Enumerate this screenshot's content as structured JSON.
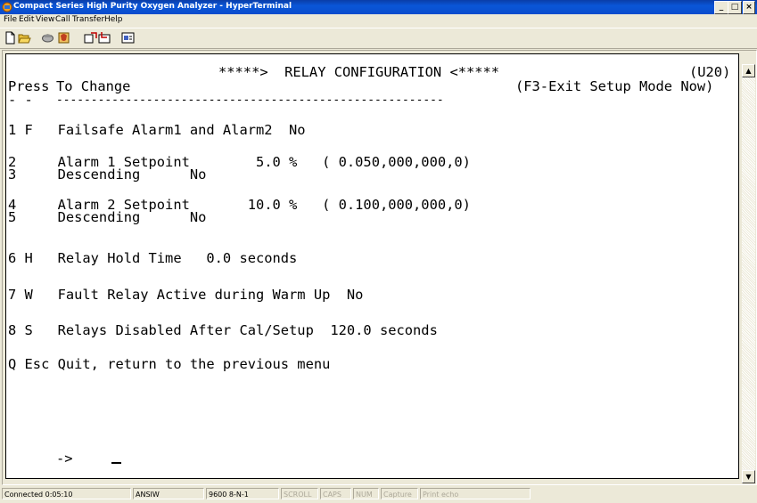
{
  "window": {
    "title": "Compact Series High Purity Oxygen Analyzer - HyperTerminal",
    "minimize": "_",
    "maximize": "□",
    "close": "×"
  },
  "menu": [
    "File",
    "Edit",
    "View",
    "Call",
    "Transfer",
    "Help"
  ],
  "toolbar_icons": [
    "new-icon",
    "open-icon",
    "disconnect-icon",
    "dial-icon",
    "send-icon",
    "receive-icon",
    "properties-icon"
  ],
  "terminal": {
    "header_title": "*****>  RELAY CONFIGURATION <*****",
    "screen_id": "(U20)",
    "press_label": "Press",
    "to_change": "To Change",
    "exit_hint": "(F3-Exit Setup Mode Now)",
    "separator_left": "- -",
    "separator": "--------------------------------------------------------",
    "lines": [
      "1 F   Failsafe Alarm1 and Alarm2  No",
      "2     Alarm 1 Setpoint        5.0 %   ( 0.050,000,000,0)",
      "3     Descending      No",
      "4     Alarm 2 Setpoint       10.0 %   ( 0.100,000,000,0)",
      "5     Descending      No",
      "6 H   Relay Hold Time   0.0 seconds",
      "7 W   Fault Relay Active during Warm Up  No",
      "8 S   Relays Disabled After Cal/Setup  120.0 seconds",
      "Q Esc Quit, return to the previous menu"
    ],
    "prompt": "->"
  },
  "status": {
    "connected": "Connected 0:05:10",
    "emulation": "ANSIW",
    "port": "9600 8-N-1",
    "scroll": "SCROLL",
    "caps": "CAPS",
    "num": "NUM",
    "capture": "Capture",
    "print_echo": "Print echo"
  },
  "colors": {
    "title_bar": "#0a4ccc",
    "chrome": "#ece9d8",
    "terminal_bg": "#ffffff",
    "terminal_text": "#000000"
  }
}
